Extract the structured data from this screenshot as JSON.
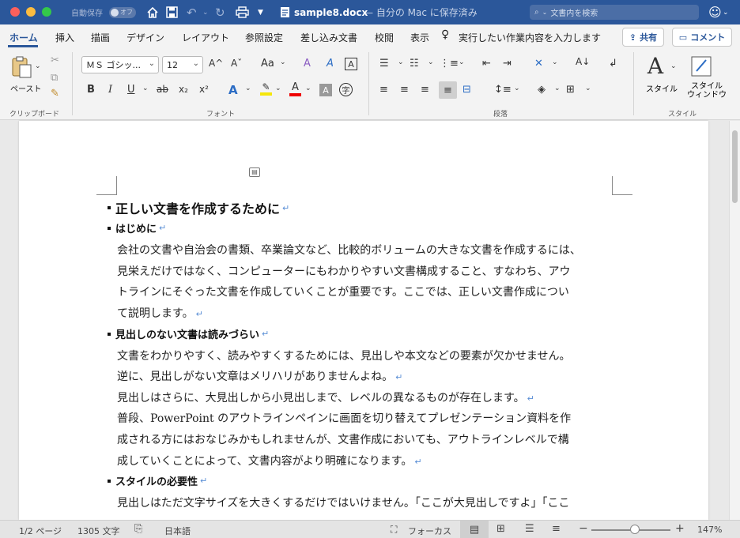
{
  "colors": {
    "accent": "#2b579a",
    "close": "#fc605c",
    "minimize": "#fdbc40",
    "zoom": "#34c84a"
  },
  "titlebar": {
    "autosave_label": "自動保存",
    "autosave_state": "オフ",
    "document_name": "sample8.docx",
    "save_status": "— 自分の Mac に保存済み",
    "search_placeholder": "文書内を検索"
  },
  "tabs": [
    "ホーム",
    "挿入",
    "描画",
    "デザイン",
    "レイアウト",
    "参照設定",
    "差し込み文書",
    "校閲",
    "表示"
  ],
  "tell_me": "実行したい作業内容を入力します",
  "share_label": "共有",
  "comment_label": "コメント",
  "ribbon": {
    "paste_label": "ペースト",
    "clipboard_group": "クリップボード",
    "font_name": "ＭＳ ゴシッ...",
    "font_size": "12",
    "font_group": "フォント",
    "paragraph_group": "段落",
    "style_label": "スタイル",
    "style_window_label1": "スタイル",
    "style_window_label2": "ウィンドウ",
    "style_group": "スタイル",
    "font_buttons": {
      "bold": "B",
      "italic": "I",
      "underline": "U",
      "strike": "ab",
      "subscript": "x₂",
      "superscript": "x²",
      "grow": "A^",
      "shrink": "Aˇ",
      "case": "Aa",
      "clear": "A",
      "box": "A"
    }
  },
  "document": {
    "title": "正しい文書を作成するために",
    "sections": [
      {
        "heading": "はじめに",
        "lines": [
          "会社の文書や自治会の書類、卒業論文など、比較的ボリュームの大きな文書を作成するには、",
          "見栄えだけではなく、コンピューターにもわかりやすい文書構成すること、すなわち、アウ",
          "トラインにそぐった文書を作成していくことが重要です。ここでは、正しい文書作成につい",
          "て説明します。"
        ]
      },
      {
        "heading": "見出しのない文書は読みづらい",
        "lines": [
          "文書をわかりやすく、読みやすくするためには、見出しや本文などの要素が欠かせません。",
          "逆に、見出しがない文章はメリハリがありませんよね。",
          "見出しはさらに、大見出しから小見出しまで、レベルの異なるものが存在します。",
          "普段、PowerPoint のアウトラインペインに画面を切り替えてプレゼンテーション資料を作",
          "成される方にはおなじみかもしれませんが、文書作成においても、アウトラインレベルで構",
          "成していくことによって、文書内容がより明確になります。"
        ]
      },
      {
        "heading": "スタイルの必要性",
        "lines": [
          "見出しはただ文字サイズを大きくするだけではいけません。「ここが大見出しですよ」「ここ"
        ]
      }
    ],
    "para_mark": "↵"
  },
  "statusbar": {
    "page": "1/2 ページ",
    "words": "1305 文字",
    "language": "日本語",
    "focus": "フォーカス",
    "zoom": "147%",
    "zoom_level": 0.47
  }
}
